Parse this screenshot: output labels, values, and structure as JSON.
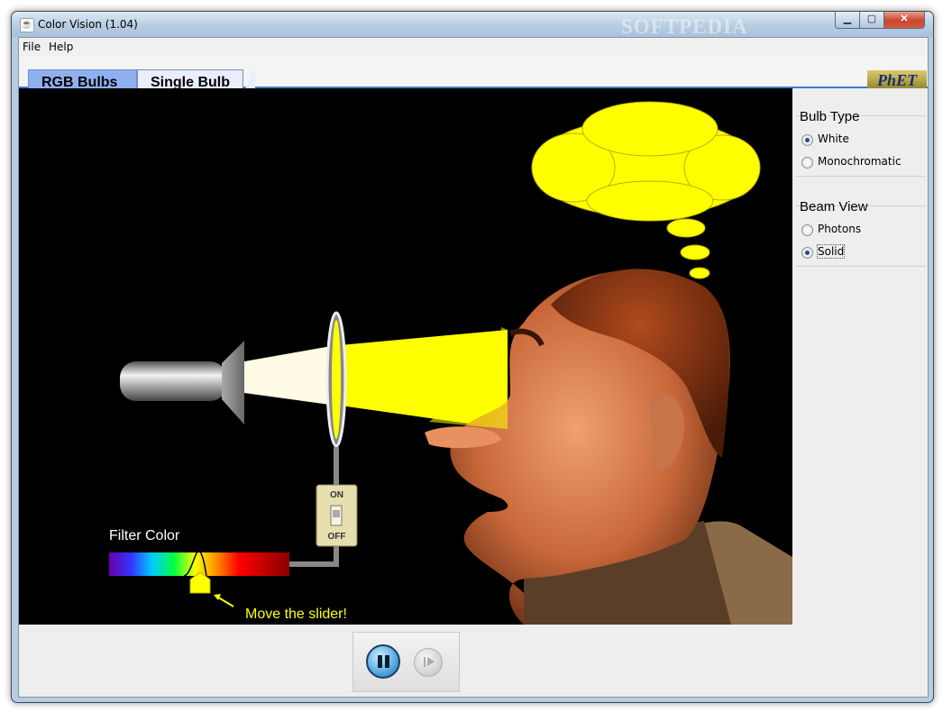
{
  "window": {
    "title": "Color Vision (1.04)",
    "watermark": "SOFTPEDIA"
  },
  "menu": {
    "items": [
      "File",
      "Help"
    ]
  },
  "tabs": [
    {
      "label": "RGB Bulbs",
      "selected": false
    },
    {
      "label": "Single Bulb",
      "selected": true
    }
  ],
  "logo": {
    "text": "PhET"
  },
  "simulation": {
    "filter_label": "Filter Color",
    "slider_hint": "Move the slider!",
    "switch": {
      "on_label": "ON",
      "off_label": "OFF"
    },
    "thought_color": "#ffff00",
    "beam_color": "#ffff00"
  },
  "panel": {
    "bulb_type": {
      "title": "Bulb Type",
      "options": [
        {
          "label": "White",
          "selected": true
        },
        {
          "label": "Monochromatic",
          "selected": false
        }
      ]
    },
    "beam_view": {
      "title": "Beam View",
      "options": [
        {
          "label": "Photons",
          "selected": false
        },
        {
          "label": "Solid",
          "selected": true
        }
      ]
    }
  },
  "controls": {
    "pause_icon": "pause-icon",
    "step_icon": "step-icon"
  }
}
